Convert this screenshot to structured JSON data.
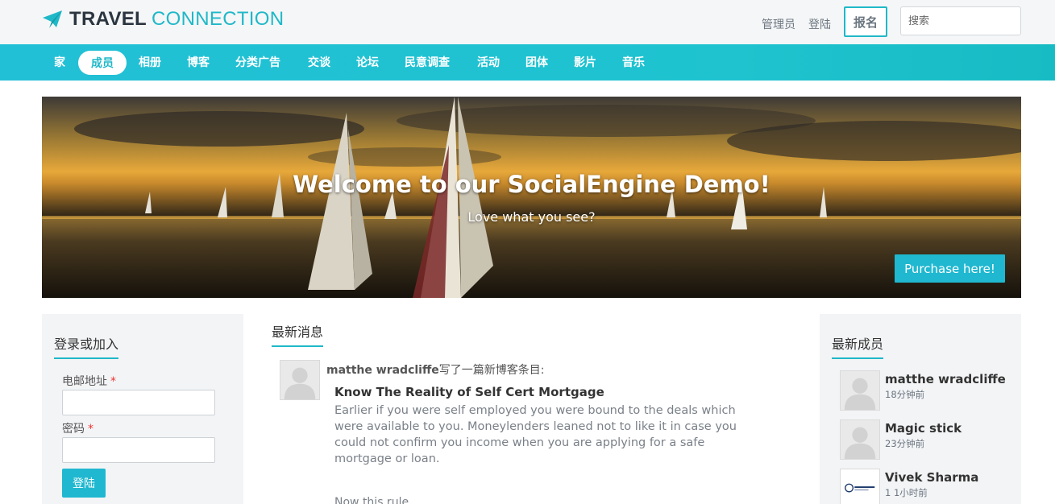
{
  "header": {
    "logo_bold": "TRAVEL",
    "logo_light": "CONNECTION",
    "admin_link": "管理员",
    "login_link": "登陆",
    "signup_button": "报名",
    "search_placeholder": "搜索"
  },
  "nav": {
    "items": [
      {
        "label": "家"
      },
      {
        "label": "成员",
        "active": true
      },
      {
        "label": "相册"
      },
      {
        "label": "博客"
      },
      {
        "label": "分类广告"
      },
      {
        "label": "交谈"
      },
      {
        "label": "论坛"
      },
      {
        "label": "民意调查"
      },
      {
        "label": "活动"
      },
      {
        "label": "团体"
      },
      {
        "label": "影片"
      },
      {
        "label": "音乐"
      }
    ]
  },
  "banner": {
    "title": "Welcome to our SocialEngine Demo!",
    "subtitle": "Love what you see?",
    "purchase_button": "Purchase here!"
  },
  "login_panel": {
    "title": "登录或加入",
    "email_label": "电邮地址",
    "password_label": "密码",
    "required_mark": "*",
    "submit_button": "登陆"
  },
  "feed": {
    "title": "最新消息",
    "items": [
      {
        "author": "matthe wradcliffe",
        "action": "写了一篇新博客条目:",
        "post_title": "Know The Reality of Self Cert Mortgage",
        "excerpt": "Earlier if you were self employed you were bound to the deals which were available to you. Moneylenders leaned not to like it in case you could not confirm you income when you are applying for a safe mortgage or loan.",
        "more": "Now this rule"
      }
    ]
  },
  "members_panel": {
    "title": "最新成员",
    "members": [
      {
        "name": "matthe wradcliffe",
        "time": "18分钟前",
        "avatar": "default-user-icon"
      },
      {
        "name": "Magic stick",
        "time": "23分钟前",
        "avatar": "default-user-icon"
      },
      {
        "name": "Vivek Sharma",
        "time": "1 1小时前",
        "avatar": "vs-logo"
      }
    ]
  },
  "colors": {
    "accent": "#1fb8c8",
    "nav_bg": "#22c0d6",
    "button_bg": "#1fb8d0",
    "panel_bg": "#f3f4f6"
  }
}
